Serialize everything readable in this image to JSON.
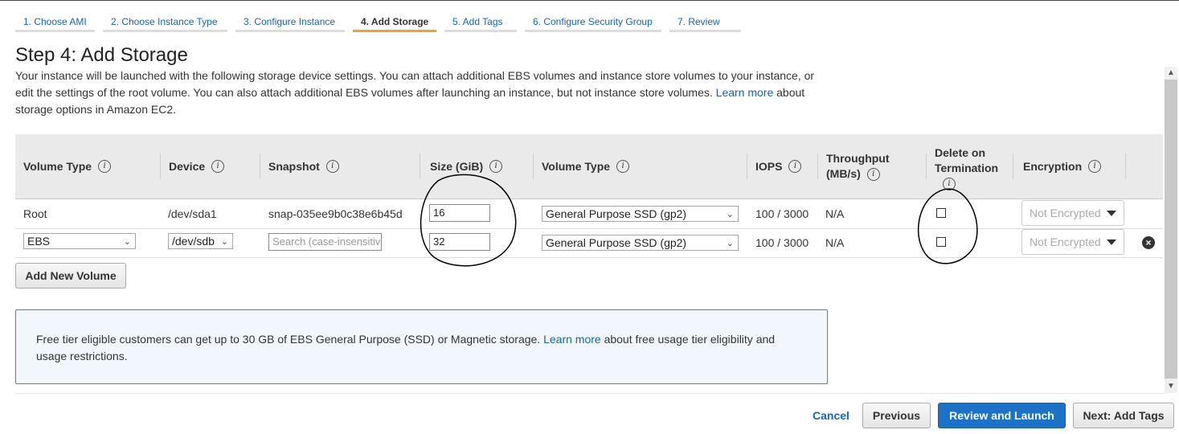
{
  "wizard": {
    "steps": [
      {
        "label": "1. Choose AMI"
      },
      {
        "label": "2. Choose Instance Type"
      },
      {
        "label": "3. Configure Instance"
      },
      {
        "label": "4. Add Storage",
        "active": true
      },
      {
        "label": "5. Add Tags"
      },
      {
        "label": "6. Configure Security Group"
      },
      {
        "label": "7. Review"
      }
    ]
  },
  "page": {
    "title": "Step 4: Add Storage",
    "desc_text": "Your instance will be launched with the following storage device settings. You can attach additional EBS volumes and instance store volumes to your instance, or edit the settings of the root volume. You can also attach additional EBS volumes after launching an instance, but not instance store volumes.",
    "desc_link": "Learn more",
    "desc_tail": "about storage options in Amazon EC2."
  },
  "table": {
    "headers": {
      "volume_type": "Volume Type",
      "device": "Device",
      "snapshot": "Snapshot",
      "size": "Size (GiB)",
      "volume_type2": "Volume Type",
      "iops": "IOPS",
      "throughput_line1": "Throughput",
      "throughput_line2": "(MB/s)",
      "delete_line1": "Delete on",
      "delete_line2": "Termination",
      "encryption": "Encryption"
    },
    "info_icon": "i",
    "rows": [
      {
        "volume_type": "Root",
        "device": "/dev/sda1",
        "snapshot": "snap-035ee9b0c38e6b45d",
        "size": "16",
        "vol_type": "General Purpose SSD (gp2)",
        "iops": "100 / 3000",
        "throughput": "N/A",
        "delete_on_termination": false,
        "encryption": "Not Encrypted"
      },
      {
        "volume_type": "EBS",
        "device": "/dev/sdb",
        "snapshot_placeholder": "Search (case-insensitive)",
        "size": "32",
        "vol_type": "General Purpose SSD (gp2)",
        "iops": "100 / 3000",
        "throughput": "N/A",
        "delete_on_termination": false,
        "encryption": "Not Encrypted"
      }
    ],
    "add_button": "Add New Volume"
  },
  "notice": {
    "text": "Free tier eligible customers can get up to 30 GB of EBS General Purpose (SSD) or Magnetic storage.",
    "link": "Learn more",
    "tail": "about free usage tier eligibility and usage restrictions."
  },
  "footer": {
    "cancel": "Cancel",
    "previous": "Previous",
    "review_launch": "Review and Launch",
    "next": "Next: Add Tags"
  },
  "colors": {
    "link": "#1166bb",
    "active_step_underline": "#f0a030",
    "primary_button": "#1a73c9",
    "notice_border": "#3b88c3"
  }
}
